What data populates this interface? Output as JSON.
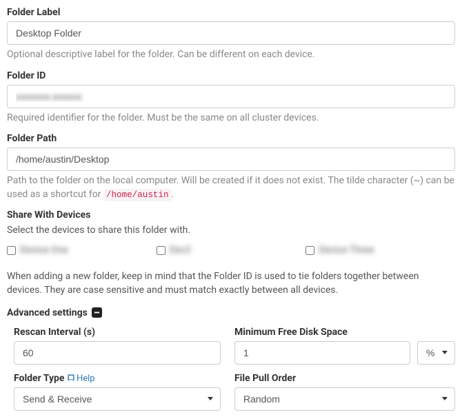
{
  "folderLabel": {
    "label": "Folder Label",
    "value": "Desktop Folder",
    "help": "Optional descriptive label for the folder. Can be different on each device."
  },
  "folderId": {
    "label": "Folder ID",
    "value": "xxxxxxx-xxxxxx",
    "help": "Required identifier for the folder. Must be the same on all cluster devices."
  },
  "folderPath": {
    "label": "Folder Path",
    "value": "/home/austin/Desktop",
    "helpPrefix": "Path to the folder on the local computer. Will be created if it does not exist. The tilde character (~) can be used as a shortcut for ",
    "helpCode": "/home/austin",
    "helpSuffix": "."
  },
  "shareDevices": {
    "label": "Share With Devices",
    "help": "Select the devices to share this folder with.",
    "devices": [
      {
        "name": "Device One"
      },
      {
        "name": "Dev2"
      },
      {
        "name": "Device Three"
      }
    ]
  },
  "note": "When adding a new folder, keep in mind that the Folder ID is used to tie folders together between devices. They are case sensitive and must match exactly between all devices.",
  "advanced": {
    "header": "Advanced settings",
    "rescan": {
      "label": "Rescan Interval (s)",
      "value": "60"
    },
    "minDisk": {
      "label": "Minimum Free Disk Space",
      "value": "1",
      "unit": "%"
    },
    "folderType": {
      "label": "Folder Type",
      "helpLink": "Help",
      "value": "Send & Receive"
    },
    "pullOrder": {
      "label": "File Pull Order",
      "value": "Random"
    }
  }
}
